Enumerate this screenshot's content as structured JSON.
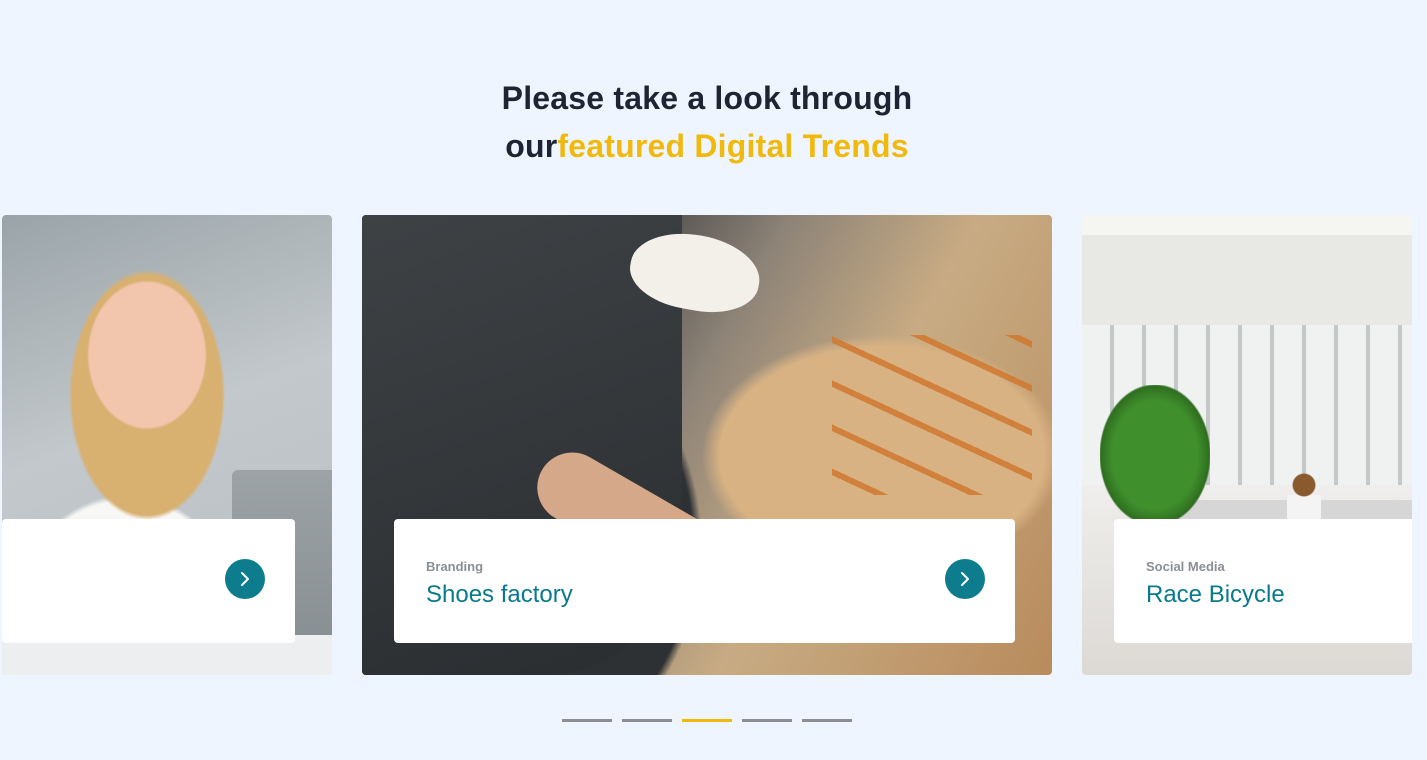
{
  "heading": {
    "line1": "Please take a look through",
    "line2_plain": "our",
    "line2_accent": "featured Digital Trends"
  },
  "cards": [
    {
      "category": "",
      "title": "",
      "has_arrow": true,
      "icon": "chevron-right-icon"
    },
    {
      "category": "Branding",
      "title": "Shoes factory",
      "has_arrow": true,
      "icon": "chevron-right-icon"
    },
    {
      "category": "Social Media",
      "title": "Race Bicycle",
      "has_arrow": false
    }
  ],
  "pagination": {
    "count": 5,
    "active_index": 2
  },
  "colors": {
    "background": "#eef5fe",
    "accent": "#f0b90b",
    "title_teal": "#087a8b",
    "button_teal": "#0d7c8c",
    "dot_inactive": "#8b8e93"
  }
}
